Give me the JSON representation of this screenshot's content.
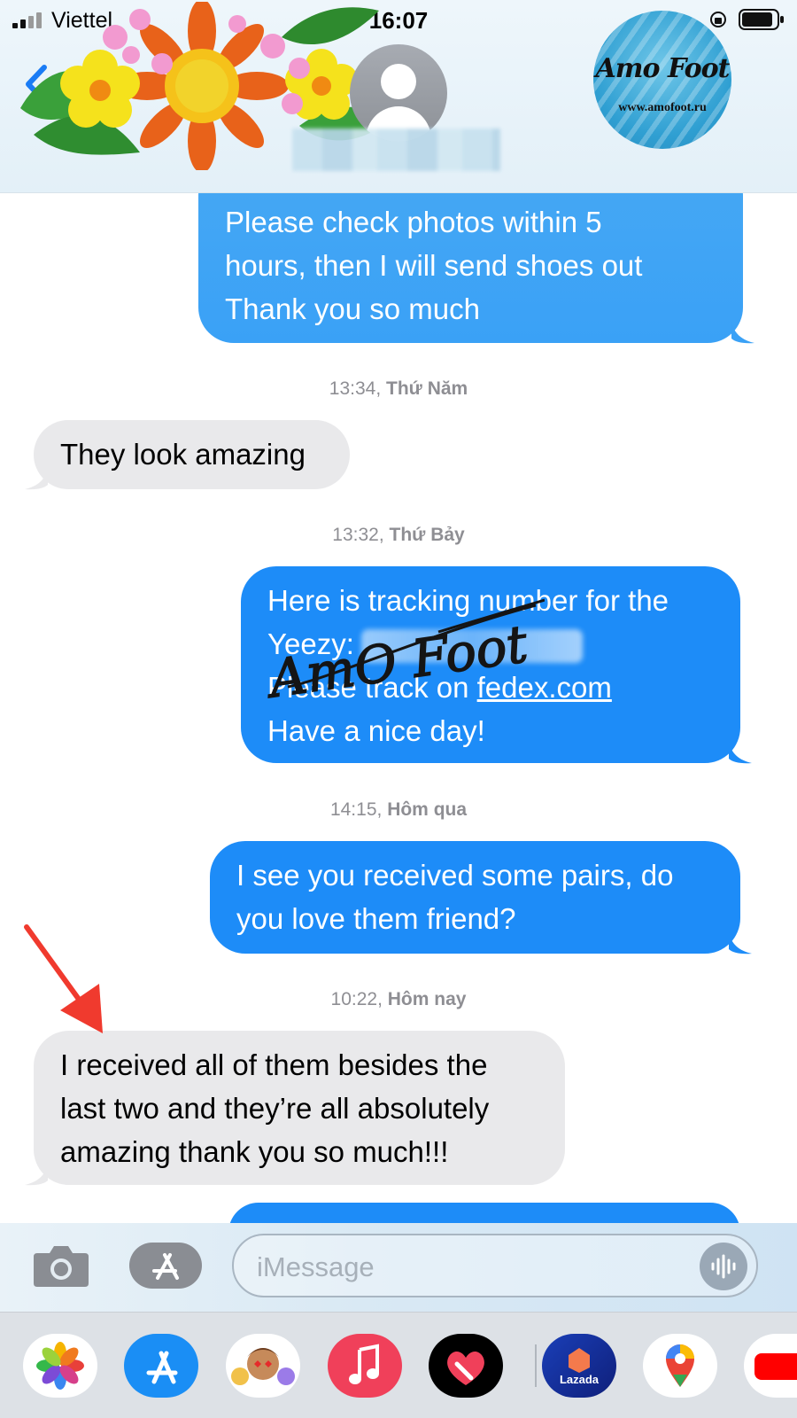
{
  "status_bar": {
    "carrier": "Viettel",
    "time": "16:07"
  },
  "header": {
    "logo": {
      "title": "Amo Foot",
      "url": "www.amofoot.ru"
    }
  },
  "messages": [
    {
      "direction": "outgoing",
      "lines": [
        "Please check photos within 5",
        "hours, then I will send shoes out",
        "Thank you so much"
      ]
    },
    {
      "kind": "timestamp",
      "time": "13:34,",
      "day": "Thứ Năm"
    },
    {
      "direction": "incoming",
      "lines": [
        "They look amazing"
      ]
    },
    {
      "kind": "timestamp",
      "time": "13:32,",
      "day": "Thứ Bảy"
    },
    {
      "direction": "outgoing",
      "lines": [
        "Here is tracking number for the",
        "Yeezy:",
        "Please track on ",
        "Have a nice day!"
      ],
      "link": "fedex.com",
      "watermark": "AmO Foot"
    },
    {
      "kind": "timestamp",
      "time": "14:15,",
      "day": "Hôm qua"
    },
    {
      "direction": "outgoing",
      "lines": [
        "I see you received some pairs, do",
        "you love them friend?"
      ]
    },
    {
      "kind": "timestamp",
      "time": "10:22,",
      "day": "Hôm nay"
    },
    {
      "direction": "incoming",
      "lines": [
        "I received all of them besides the",
        "last two and they’re all absolutely",
        "amazing thank you so much!!!"
      ]
    }
  ],
  "composer": {
    "placeholder": "iMessage"
  },
  "app_drawer": {
    "apps": [
      {
        "name": "photos-app-icon"
      },
      {
        "name": "app-store-app-icon"
      },
      {
        "name": "memoji-app-icon"
      },
      {
        "name": "music-app-icon"
      },
      {
        "name": "digital-touch-app-icon"
      },
      {
        "name": "lazada-app-icon",
        "label": "Lazada"
      },
      {
        "name": "google-maps-app-icon"
      },
      {
        "name": "youtube-app-icon"
      }
    ]
  },
  "colors": {
    "outgoing_bubble": "#1d8cf8",
    "incoming_bubble": "#e9e9eb",
    "timestamp_text": "#8e8e93",
    "annotation_arrow": "#f03a2e"
  }
}
